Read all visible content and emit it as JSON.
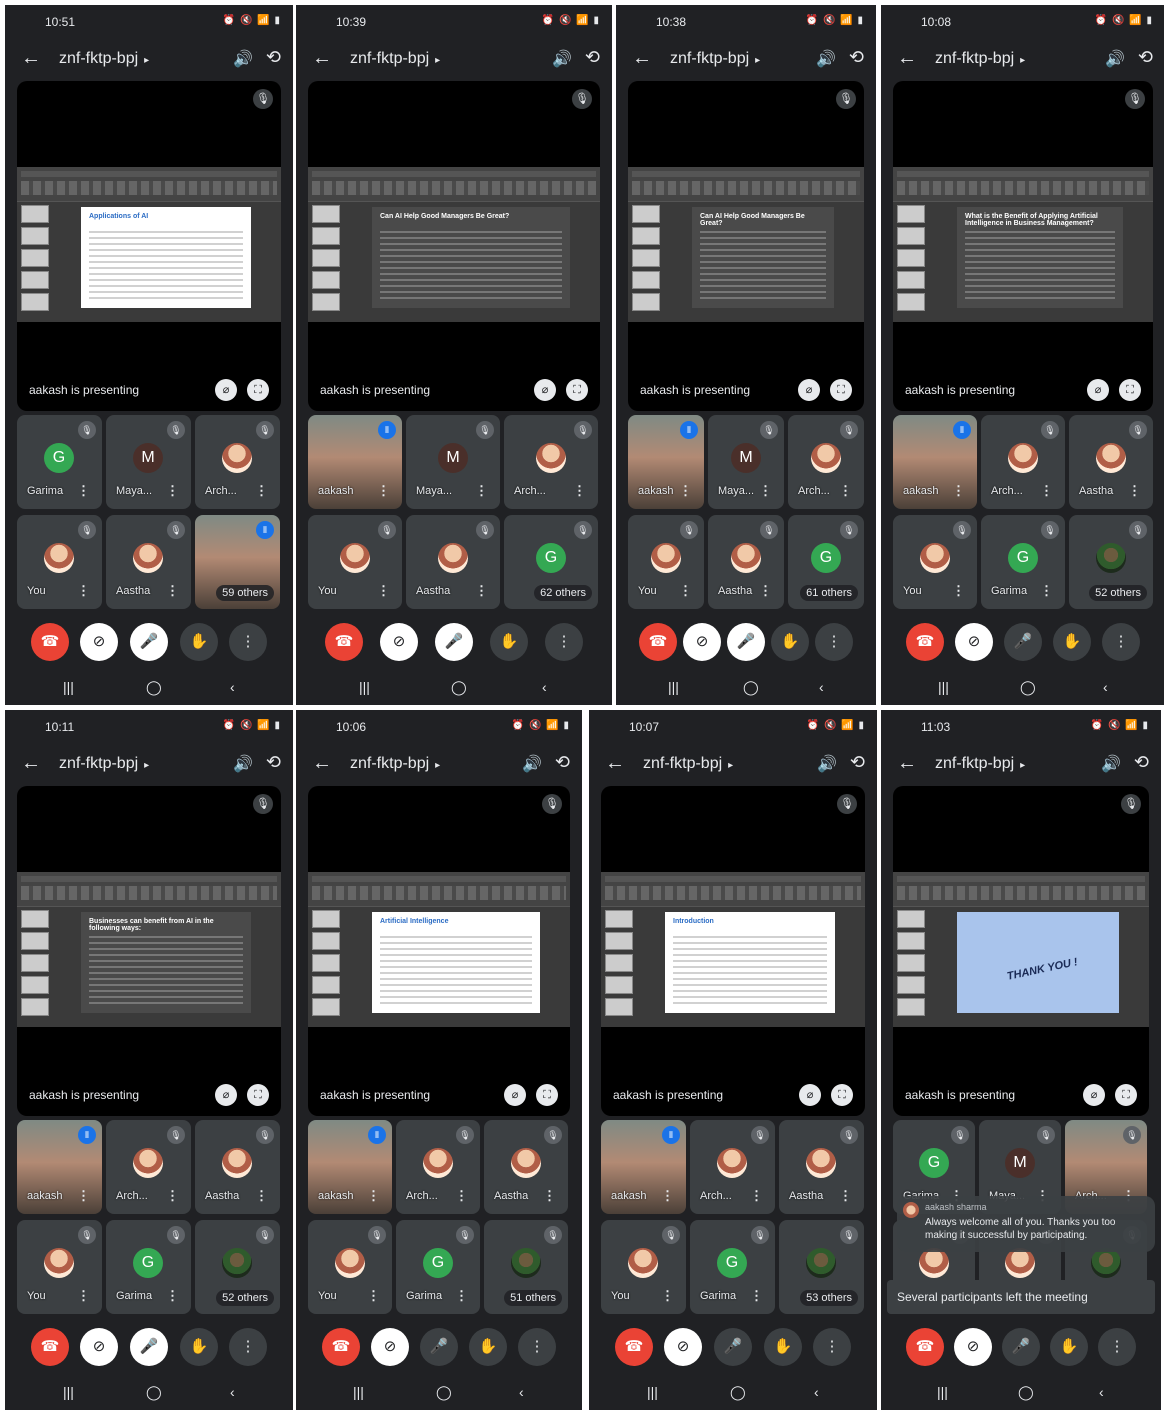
{
  "meeting_title": "znf-fktp-bpj",
  "presenting_text": "aakash is presenting",
  "panels": [
    {
      "time": "10:51",
      "slide": {
        "title": "Applications of AI",
        "style": "light"
      },
      "tiles": [
        {
          "name": "Garima",
          "avatar_letter": "G",
          "avatar": "G",
          "muted": true
        },
        {
          "name": "Maya...",
          "avatar_letter": "M",
          "avatar": "M",
          "muted": true
        },
        {
          "name": "Arch...",
          "avatar": "photo",
          "muted": true
        },
        {
          "name": "You",
          "avatar": "photo",
          "muted": true
        },
        {
          "name": "Aastha",
          "avatar": "photo",
          "muted": true
        },
        {
          "name": "",
          "avatar": "video",
          "speaking": true,
          "others": "59 others"
        }
      ],
      "mic_muted": true
    },
    {
      "time": "10:39",
      "slide": {
        "title": "Can AI Help Good Managers Be Great?",
        "style": "dark"
      },
      "tiles": [
        {
          "name": "aakash",
          "avatar": "video",
          "speaking": true
        },
        {
          "name": "Maya...",
          "avatar_letter": "M",
          "avatar": "M",
          "muted": true
        },
        {
          "name": "Arch...",
          "avatar": "photo",
          "muted": true
        },
        {
          "name": "You",
          "avatar": "photo",
          "muted": true
        },
        {
          "name": "Aastha",
          "avatar": "photo",
          "muted": true
        },
        {
          "name": "",
          "avatar_letter": "G",
          "avatar": "G",
          "muted": true,
          "others": "62 others"
        }
      ],
      "mic_muted": true
    },
    {
      "time": "10:38",
      "slide": {
        "title": "Can AI Help Good Managers Be Great?",
        "style": "dark"
      },
      "tiles": [
        {
          "name": "aakash",
          "avatar": "video",
          "speaking": true
        },
        {
          "name": "Maya...",
          "avatar_letter": "M",
          "avatar": "M",
          "muted": true
        },
        {
          "name": "Arch...",
          "avatar": "photo",
          "muted": true
        },
        {
          "name": "You",
          "avatar": "photo",
          "muted": true
        },
        {
          "name": "Aastha",
          "avatar": "photo",
          "muted": true
        },
        {
          "name": "",
          "avatar_letter": "G",
          "avatar": "G",
          "muted": true,
          "others": "61 others"
        }
      ],
      "mic_muted": true
    },
    {
      "time": "10:08",
      "slide": {
        "title": "What is the Benefit of Applying Artificial Intelligence in Business Management?",
        "style": "dark"
      },
      "tiles": [
        {
          "name": "aakash",
          "avatar": "video",
          "speaking": true
        },
        {
          "name": "Arch...",
          "avatar": "photo",
          "muted": true
        },
        {
          "name": "Aastha",
          "avatar": "photo",
          "muted": true
        },
        {
          "name": "You",
          "avatar": "photo",
          "muted": true
        },
        {
          "name": "Garima",
          "avatar_letter": "G",
          "avatar": "G",
          "muted": true
        },
        {
          "name": "",
          "avatar": "dark",
          "muted": true,
          "others": "52 others"
        }
      ],
      "mic_muted": false
    },
    {
      "time": "10:11",
      "slide": {
        "title": "Businesses can benefit from AI in the following ways:",
        "style": "dark"
      },
      "tiles": [
        {
          "name": "aakash",
          "avatar": "video",
          "speaking": true
        },
        {
          "name": "Arch...",
          "avatar": "photo",
          "muted": true
        },
        {
          "name": "Aastha",
          "avatar": "photo",
          "muted": true
        },
        {
          "name": "You",
          "avatar": "photo",
          "muted": true
        },
        {
          "name": "Garima",
          "avatar_letter": "G",
          "avatar": "G",
          "muted": true
        },
        {
          "name": "",
          "avatar": "dark",
          "muted": true,
          "others": "52 others"
        }
      ],
      "mic_muted": true
    },
    {
      "time": "10:06",
      "slide": {
        "title": "Artificial Intelligence",
        "style": "light"
      },
      "tiles": [
        {
          "name": "aakash",
          "avatar": "video",
          "speaking": true
        },
        {
          "name": "Arch...",
          "avatar": "photo",
          "muted": true
        },
        {
          "name": "Aastha",
          "avatar": "photo",
          "muted": true
        },
        {
          "name": "You",
          "avatar": "photo",
          "muted": true
        },
        {
          "name": "Garima",
          "avatar_letter": "G",
          "avatar": "G",
          "muted": true
        },
        {
          "name": "",
          "avatar": "dark",
          "muted": true,
          "others": "51 others"
        }
      ],
      "mic_muted": false
    },
    {
      "time": "10:07",
      "slide": {
        "title": "Introduction",
        "style": "light"
      },
      "tiles": [
        {
          "name": "aakash",
          "avatar": "video",
          "speaking": true
        },
        {
          "name": "Arch...",
          "avatar": "photo",
          "muted": true
        },
        {
          "name": "Aastha",
          "avatar": "photo",
          "muted": true
        },
        {
          "name": "You",
          "avatar": "photo",
          "muted": true
        },
        {
          "name": "Garima",
          "avatar_letter": "G",
          "avatar": "G",
          "muted": true
        },
        {
          "name": "",
          "avatar": "dark",
          "muted": true,
          "others": "53 others"
        }
      ],
      "mic_muted": false
    },
    {
      "time": "11:03",
      "slide": {
        "title": "THANK YOU !",
        "style": "blue"
      },
      "tiles": [
        {
          "name": "Garima",
          "avatar_letter": "G",
          "avatar": "G",
          "muted": true
        },
        {
          "name": "Maya...",
          "avatar_letter": "M",
          "avatar": "M",
          "muted": true
        },
        {
          "name": "Arch...",
          "avatar": "video",
          "muted": true
        },
        {
          "name": "",
          "avatar": "photo",
          "muted": true
        },
        {
          "name": "",
          "avatar": "photo",
          "muted": true
        },
        {
          "name": "",
          "avatar": "dark",
          "muted": true
        }
      ],
      "mic_muted": false,
      "chat": {
        "sender": "aakash sharma",
        "message": "Always welcome all of you. Thanks you too making it successful by participating."
      },
      "toast": "Several participants left the meeting"
    }
  ]
}
